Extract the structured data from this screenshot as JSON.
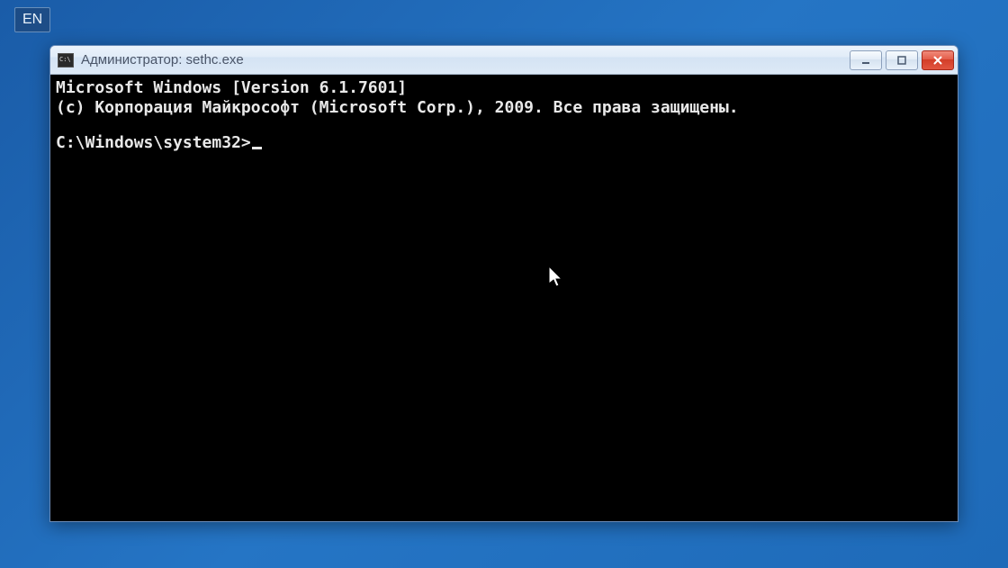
{
  "lang_indicator": "EN",
  "window": {
    "icon_text": "C:\\",
    "title": "Администратор: sethc.exe"
  },
  "console": {
    "line1": "Microsoft Windows [Version 6.1.7601]",
    "line2": "(c) Корпорация Майкрософт (Microsoft Corp.), 2009. Все права защищены.",
    "prompt": "C:\\Windows\\system32>"
  }
}
